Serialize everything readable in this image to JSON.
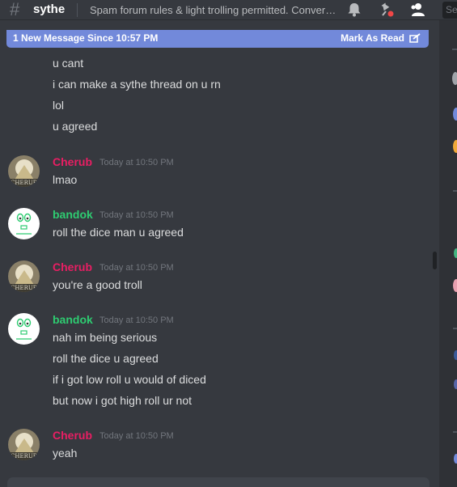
{
  "header": {
    "channel_name": "sythe",
    "topic": "Spam forum rules & light trolling permitted. Conversation is encouraged.",
    "search_label": "Se"
  },
  "new_messages_bar": {
    "text": "1 New Message Since 10:57 PM",
    "action": "Mark As Read"
  },
  "continuation_lines": [
    "u cant",
    "i can make a sythe thread on u rn",
    "lol",
    "u agreed"
  ],
  "messages": [
    {
      "author": "Cherub",
      "timestamp": "Today at 10:50 PM",
      "lines": [
        "lmao"
      ]
    },
    {
      "author": "bandok",
      "timestamp": "Today at 10:50 PM",
      "lines": [
        "roll the dice man u agreed"
      ]
    },
    {
      "author": "Cherub",
      "timestamp": "Today at 10:50 PM",
      "lines": [
        "you're a good troll"
      ]
    },
    {
      "author": "bandok",
      "timestamp": "Today at 10:50 PM",
      "lines": [
        "nah im being serious",
        "roll the dice u agreed",
        "if i got low roll u would of diced",
        "but now i got high roll ur not"
      ]
    },
    {
      "author": "Cherub",
      "timestamp": "Today at 10:50 PM",
      "lines": [
        "yeah"
      ]
    }
  ],
  "colors": {
    "background": "#36393f",
    "cherub": "#e91e63",
    "bandok": "#2ecc71",
    "accent": "#7289da"
  },
  "icons": [
    "hash-icon",
    "bell-icon",
    "pin-icon",
    "members-icon",
    "mark-read-icon"
  ]
}
